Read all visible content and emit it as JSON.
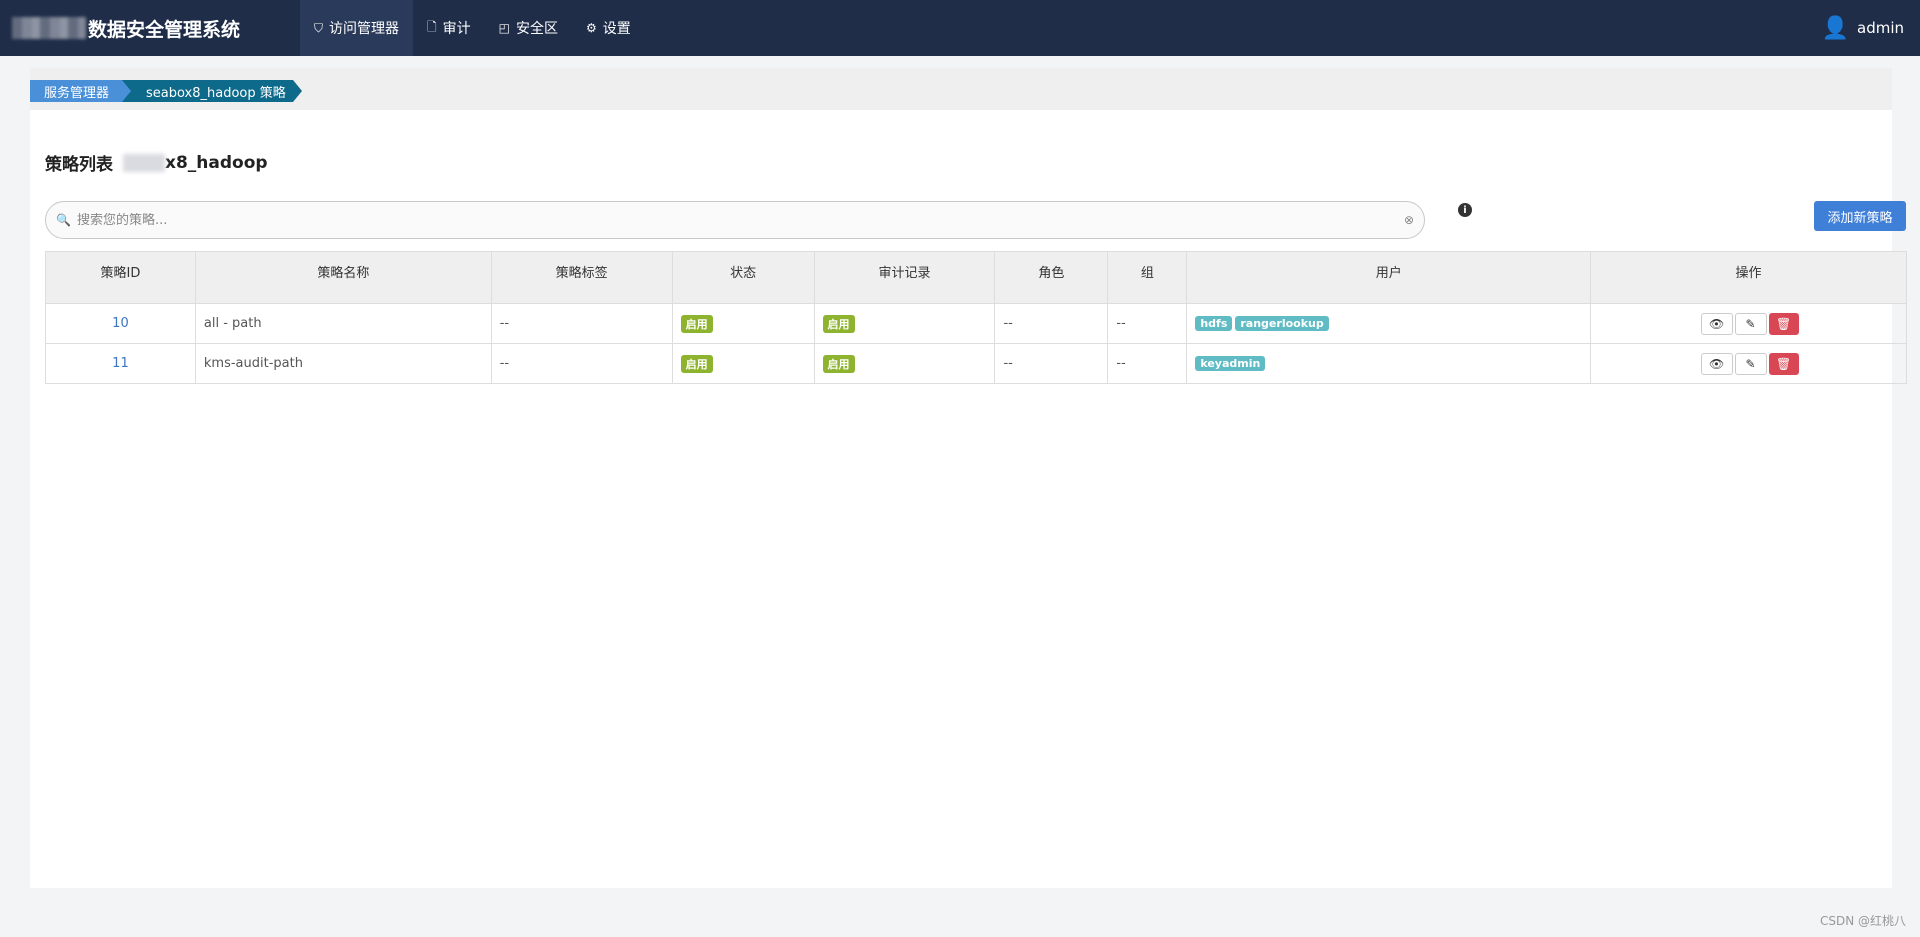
{
  "app": {
    "title_suffix": "数据安全管理系统"
  },
  "nav": [
    {
      "icon": "shield-icon",
      "glyph": "⛉",
      "label": "访问管理器",
      "active": true
    },
    {
      "icon": "file-icon",
      "glyph": "🗋",
      "label": "审计",
      "active": false
    },
    {
      "icon": "safe-icon",
      "glyph": "◰",
      "label": "安全区",
      "active": false
    },
    {
      "icon": "gear-icon",
      "glyph": "⚙",
      "label": "设置",
      "active": false
    }
  ],
  "user": {
    "name": "admin"
  },
  "breadcrumb": {
    "item1": "服务管理器",
    "item2": "seabox8_hadoop 策略"
  },
  "page": {
    "title_prefix": "策略列表",
    "title_suffix": "x8_hadoop"
  },
  "search": {
    "placeholder": "搜索您的策略..."
  },
  "add_button": "添加新策略",
  "table": {
    "headers": [
      "策略ID",
      "策略名称",
      "策略标签",
      "状态",
      "审计记录",
      "角色",
      "组",
      "用户",
      "操作"
    ],
    "rows": [
      {
        "id": "10",
        "name": "all - path",
        "labels": "--",
        "status": "启用",
        "audit": "启用",
        "roles": "--",
        "groups": "--",
        "users": [
          "hdfs",
          "rangerlookup"
        ]
      },
      {
        "id": "11",
        "name": "kms-audit-path",
        "labels": "--",
        "status": "启用",
        "audit": "启用",
        "roles": "--",
        "groups": "--",
        "users": [
          "keyadmin"
        ]
      }
    ]
  },
  "colors": {
    "nav_bg": "#1f2d49",
    "primary": "#3f7fd8",
    "enabled": "#8db32f",
    "user_tag": "#5fbcc4",
    "danger": "#d94654"
  },
  "footer": "CSDN @红桃八"
}
